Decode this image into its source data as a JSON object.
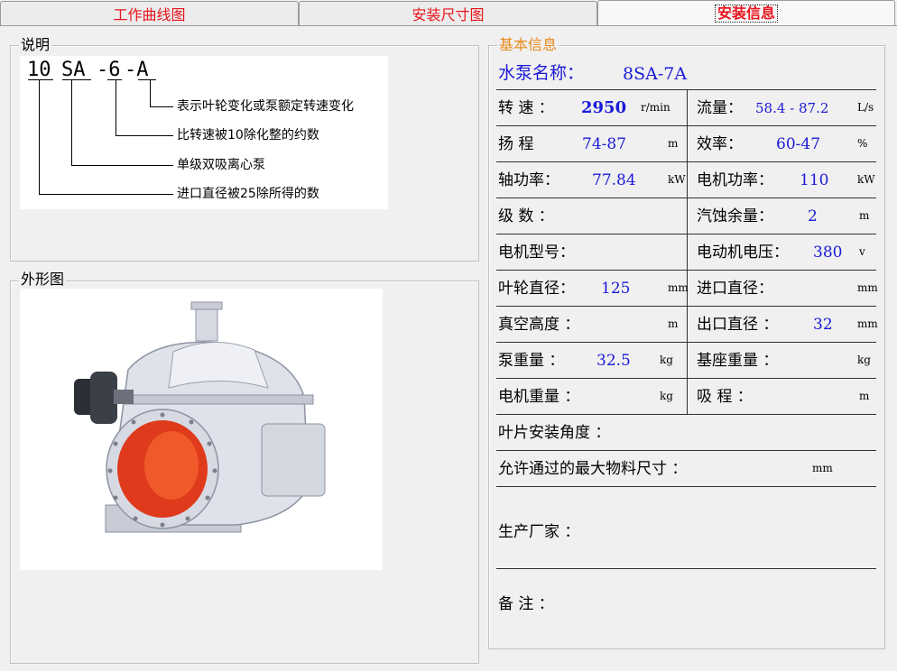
{
  "tabs": [
    "工作曲线图",
    "安装尺寸图",
    "安装信息"
  ],
  "legend_group": {
    "title": "说明",
    "code": [
      "10",
      "SA",
      "-6",
      "-A"
    ],
    "descriptions": [
      "表示叶轮变化或泵额定转速变化",
      "比转速被10除化整的约数",
      "单级双吸离心泵",
      "进口直径被25除所得的数"
    ]
  },
  "shape_group": {
    "title": "外形图"
  },
  "info": {
    "title": "基本信息",
    "pump_name_label": "水泵名称：",
    "pump_name": "8SA-7A",
    "rows": {
      "speed": {
        "label": "转 速 ：",
        "value": "2950",
        "unit": "r/min"
      },
      "flow": {
        "label": "流量：",
        "value": "58.4 - 87.2",
        "unit": "L/s"
      },
      "head": {
        "label": "扬 程",
        "value": "74-87",
        "unit": "m"
      },
      "efficiency": {
        "label": "效率：",
        "value": "60-47",
        "unit": "%"
      },
      "shaft_power": {
        "label": "轴功率：",
        "value": "77.84",
        "unit": "kW"
      },
      "motor_power": {
        "label": "电机功率：",
        "value": "110",
        "unit": "kW"
      },
      "stages": {
        "label": "级 数 ："
      },
      "npsh": {
        "label": "汽蚀余量：",
        "value": "2",
        "unit": "m"
      },
      "motor_model": {
        "label": "电机型号："
      },
      "motor_voltage": {
        "label": "电动机电压：",
        "value": "380",
        "unit": "v"
      },
      "impeller_dia": {
        "label": "叶轮直径：",
        "value": "125",
        "unit": "mm"
      },
      "inlet_dia": {
        "label": "进口直径：",
        "unit": "mm"
      },
      "vacuum_height": {
        "label": "真空高度 ：",
        "unit": "m"
      },
      "outlet_dia": {
        "label": "出口直径 ：",
        "value": "32",
        "unit": "mm"
      },
      "pump_weight": {
        "label": "泵重量 ：",
        "value": "32.5",
        "unit": "kg"
      },
      "base_weight": {
        "label": "基座重量 ：",
        "unit": "kg"
      },
      "motor_weight": {
        "label": "电机重量 ：",
        "unit": "kg"
      },
      "suction_lift": {
        "label": "吸 程 ：",
        "unit": "m"
      }
    },
    "blade_angle_label": "叶片安装角度 ：",
    "max_material_label": "允许通过的最大物料尺寸 ：",
    "max_material_unit": "mm",
    "manufacturer_label": "生产厂家 ：",
    "remarks_label": "备  注 ："
  },
  "colors": {
    "tab_text": "#e8131c",
    "value_blue": "#1a1ad8",
    "info_title": "#e88a1a",
    "pump_red": "#e03a1c"
  }
}
